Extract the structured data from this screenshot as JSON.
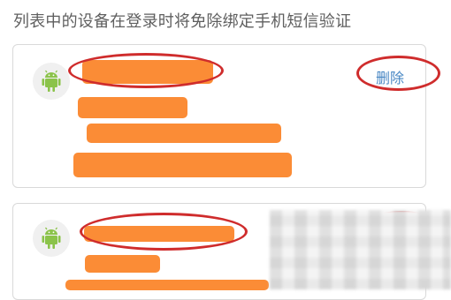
{
  "page": {
    "header_text": "列表中的设备在登录时将免除绑定手机短信验证"
  },
  "devices": [
    {
      "platform_icon": "android-icon",
      "delete_label": "删除"
    },
    {
      "platform_icon": "android-icon",
      "delete_label": ""
    }
  ],
  "colors": {
    "redaction": "#fb8c36",
    "annotation_circle": "#cf2c2c",
    "link": "#4a88c4",
    "android_green": "#8bc34a"
  }
}
